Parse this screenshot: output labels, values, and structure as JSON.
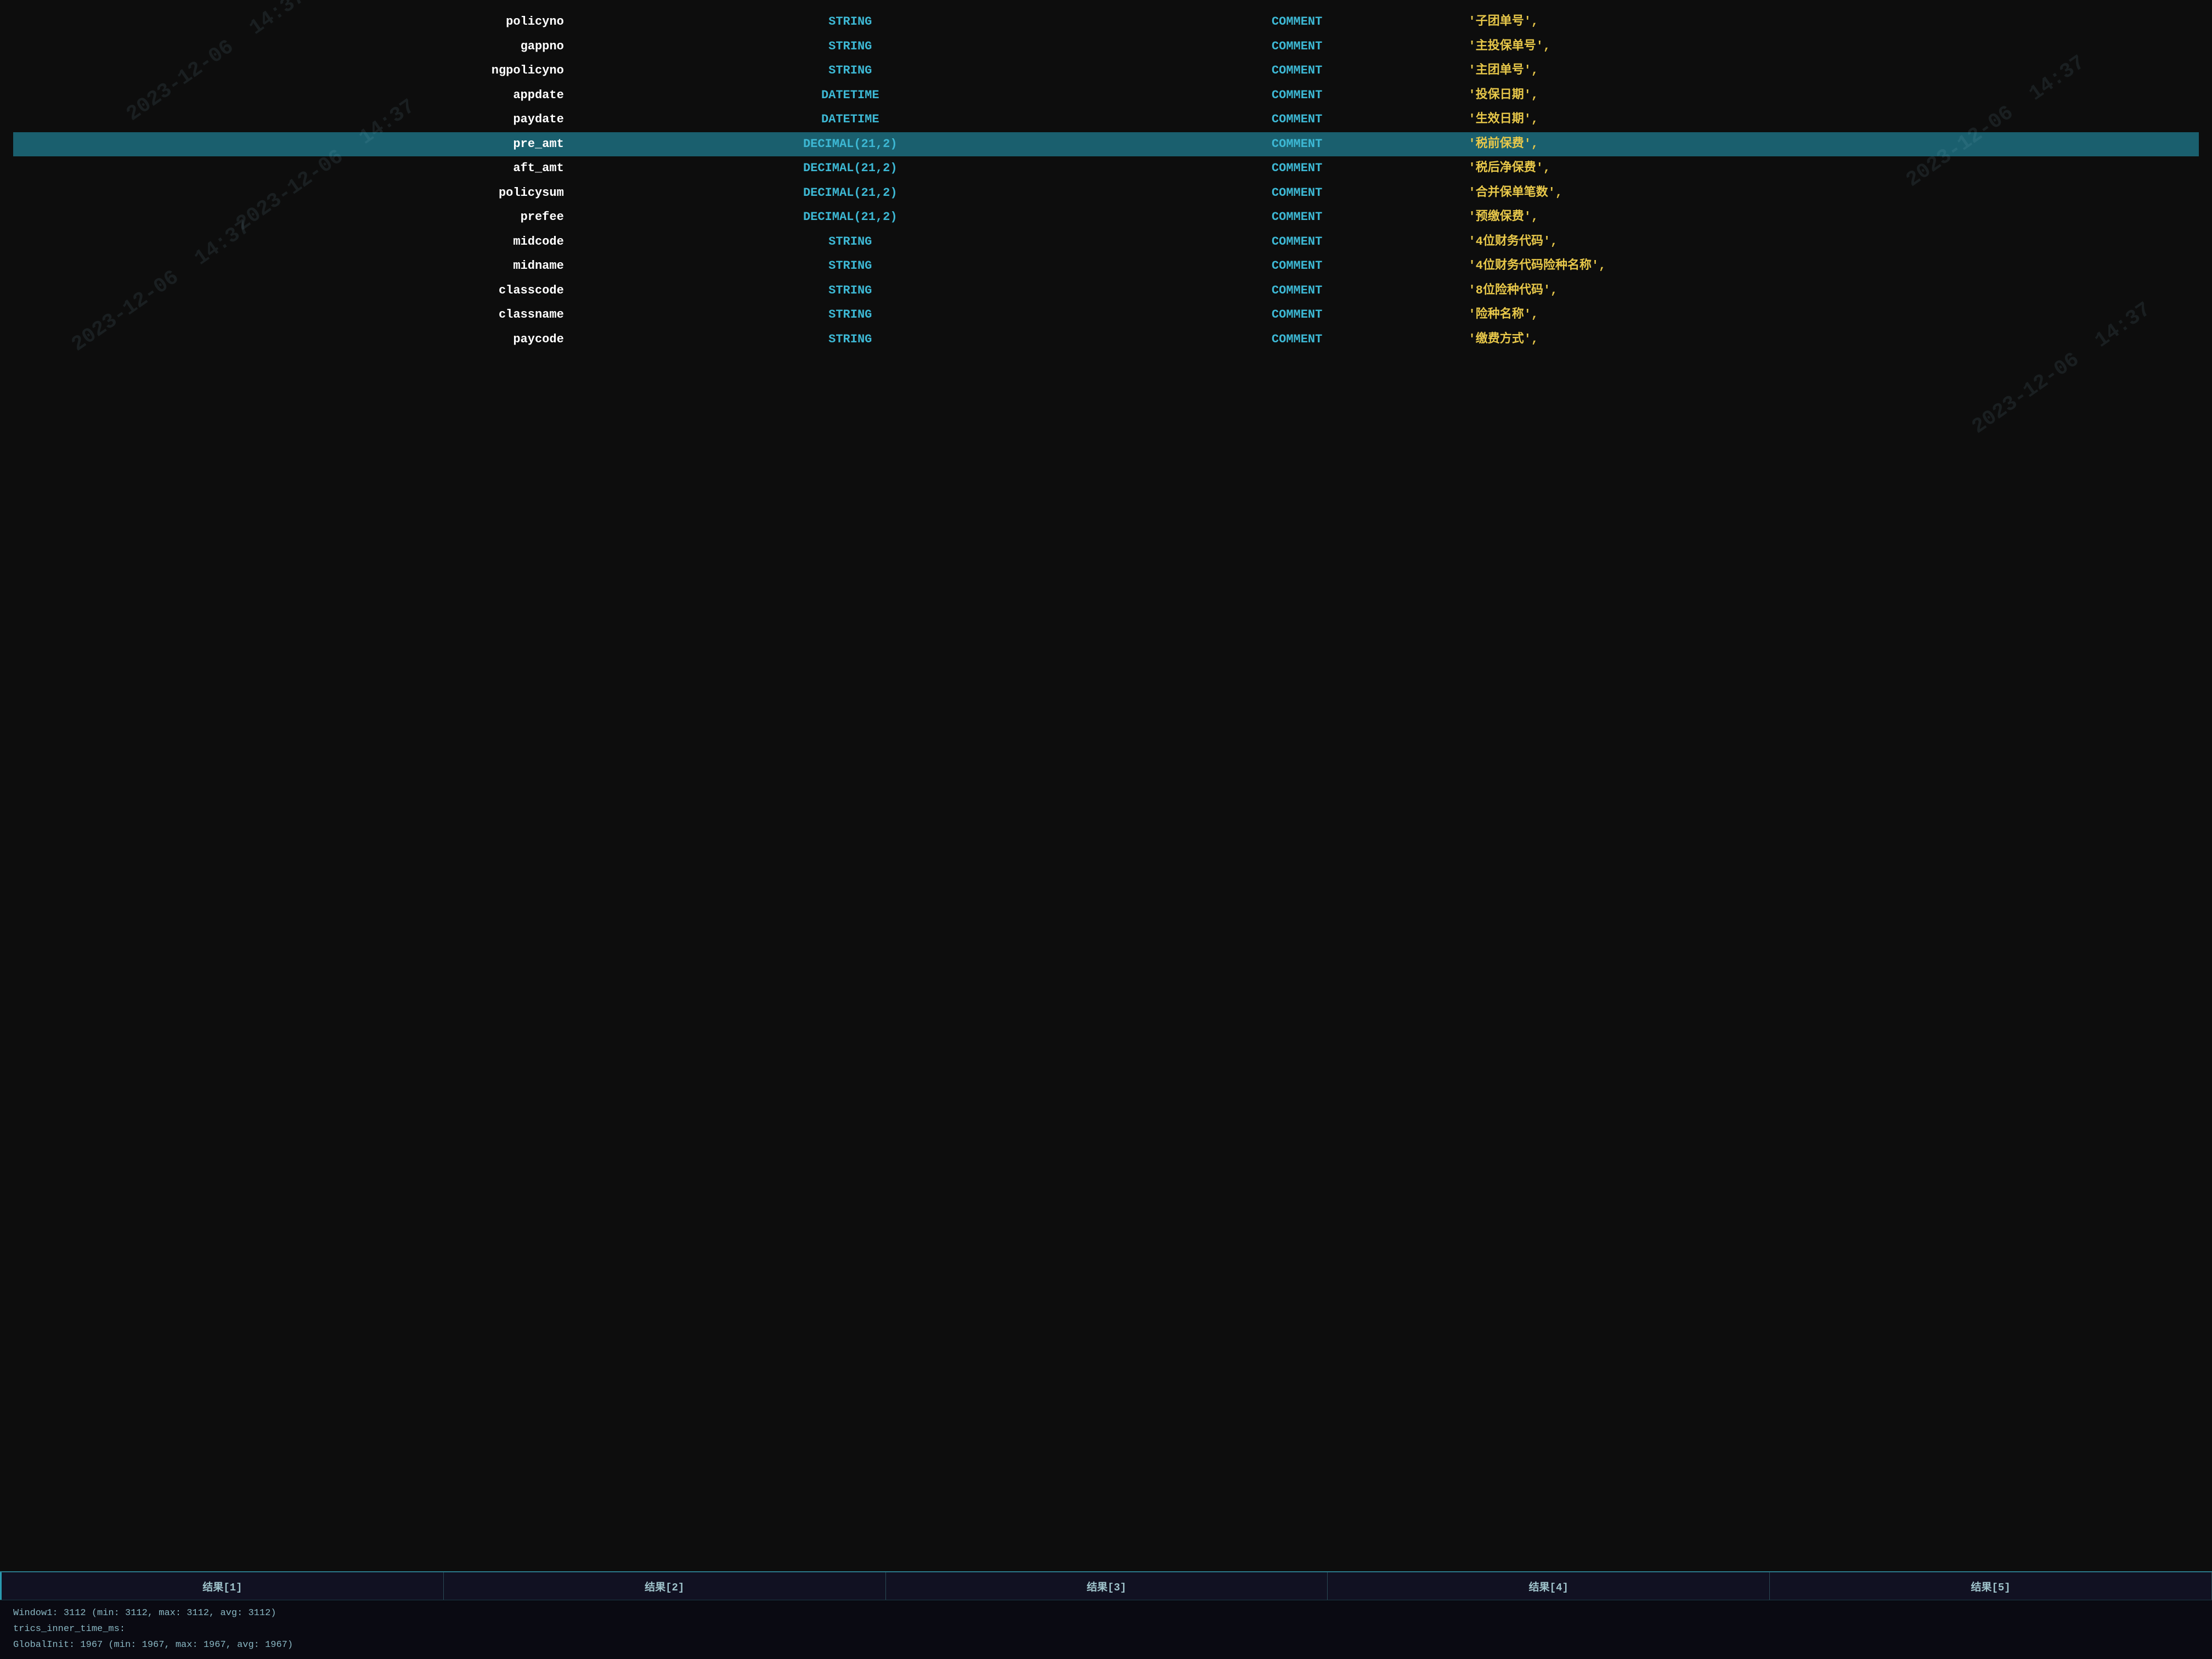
{
  "rows": [
    {
      "field": "policyno",
      "type": "STRING",
      "comment_kw": "COMMENT",
      "comment_val": "'子团单号',",
      "highlighted": false
    },
    {
      "field": "gappno",
      "type": "STRING",
      "comment_kw": "COMMENT",
      "comment_val": "'主投保单号',",
      "highlighted": false
    },
    {
      "field": "ngpolicyno",
      "type": "STRING",
      "comment_kw": "COMMENT",
      "comment_val": "'主团单号',",
      "highlighted": false
    },
    {
      "field": "appdate",
      "type": "DATETIME",
      "comment_kw": "COMMENT",
      "comment_val": "'投保日期',",
      "highlighted": false
    },
    {
      "field": "paydate",
      "type": "DATETIME",
      "comment_kw": "COMMENT",
      "comment_val": "'生效日期',",
      "highlighted": false
    },
    {
      "field": "pre_amt",
      "type": "DECIMAL(21,2)",
      "comment_kw": "COMMENT",
      "comment_val": "'税前保费',",
      "highlighted": true
    },
    {
      "field": "aft_amt",
      "type": "DECIMAL(21,2)",
      "comment_kw": "COMMENT",
      "comment_val": "'税后净保费',",
      "highlighted": false
    },
    {
      "field": "policysum",
      "type": "DECIMAL(21,2)",
      "comment_kw": "COMMENT",
      "comment_val": "'合并保单笔数',",
      "highlighted": false
    },
    {
      "field": "prefee",
      "type": "DECIMAL(21,2)",
      "comment_kw": "COMMENT",
      "comment_val": "'预缴保费',",
      "highlighted": false
    },
    {
      "field": "midcode",
      "type": "STRING",
      "comment_kw": "COMMENT",
      "comment_val": "'4位财务代码',",
      "highlighted": false
    },
    {
      "field": "midname",
      "type": "STRING",
      "comment_kw": "COMMENT",
      "comment_val": "'4位财务代码险种名称',",
      "highlighted": false
    },
    {
      "field": "classcode",
      "type": "STRING",
      "comment_kw": "COMMENT",
      "comment_val": "'8位险种代码',",
      "highlighted": false
    },
    {
      "field": "classname",
      "type": "STRING",
      "comment_kw": "COMMENT",
      "comment_val": "'险种名称',",
      "highlighted": false
    },
    {
      "field": "paycode",
      "type": "STRING",
      "comment_kw": "COMMENT",
      "comment_val": "'缴费方式',",
      "highlighted": false
    }
  ],
  "tabs": [
    {
      "label": "结果[1]"
    },
    {
      "label": "结果[2]"
    },
    {
      "label": "结果[3]"
    },
    {
      "label": "结果[4]"
    },
    {
      "label": "结果[5]"
    }
  ],
  "status": {
    "line1": "Window1: 3112  (min: 3112, max: 3112, avg: 3112)",
    "line2": "trics_inner_time_ms:",
    "line3": "GlobalInit: 1967  (min: 1967, max: 1967, avg: 1967)"
  },
  "watermarks": [
    "2023-12-06  14:37",
    "2023-12-06  14:37",
    "2023-12-06  14:37",
    "2023-12-06  14:37",
    "2023-12-06  14:37"
  ]
}
